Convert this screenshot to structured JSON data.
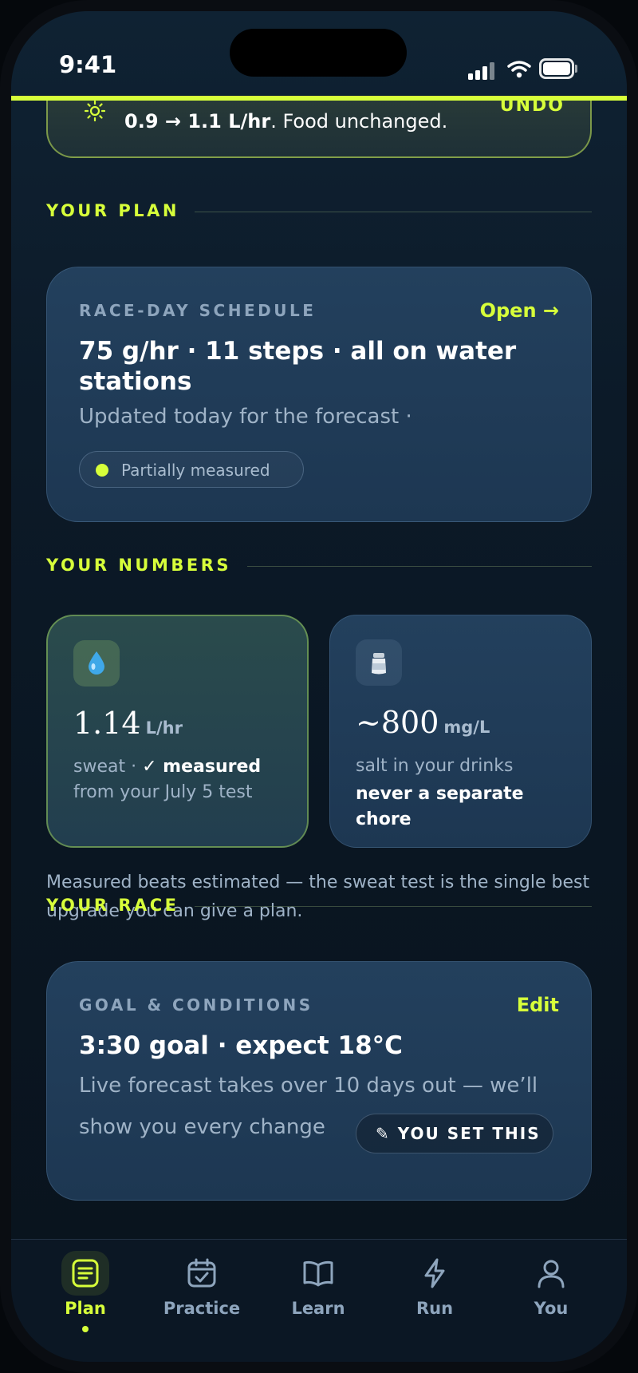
{
  "status": {
    "time": "9:41"
  },
  "banner": {
    "message_bold": "0.9 → 1.1 L/hr",
    "message_rest": ". Food unchanged.",
    "undo_label": "UNDO"
  },
  "sections": {
    "plan": "YOUR PLAN",
    "numbers": "YOUR NUMBERS",
    "race": "YOUR RACE"
  },
  "plan_card": {
    "eyebrow": "RACE-DAY SCHEDULE",
    "action": "Open →",
    "headline": "75 g/hr · 11 steps · all on water stations",
    "sub": "Updated today for the forecast ·",
    "pill": "Partially measured"
  },
  "numbers": {
    "sweat": {
      "icon": "water-drop-icon",
      "value": "1.14",
      "unit": "L/hr",
      "line1_pre": "sweat · ",
      "line1_bold": "✓ measured",
      "line2": "from your July 5 test"
    },
    "salt": {
      "icon": "salt-shaker-icon",
      "value": "~800",
      "unit": "mg/L",
      "line1": "salt in your drinks",
      "line2_bold": "never a separate chore"
    },
    "note": "Measured beats estimated — the sweat test is the single best upgrade you can give a plan."
  },
  "race_card": {
    "eyebrow": "GOAL & CONDITIONS",
    "action": "Edit",
    "headline": "3:30 goal · expect 18°C",
    "sub1": "Live forecast takes over 10 days out — we’ll",
    "sub2": "show you every change",
    "tag": "✎ YOU SET THIS"
  },
  "tabs": [
    {
      "label": "Plan",
      "icon": "plan-doc-icon",
      "active": true
    },
    {
      "label": "Practice",
      "icon": "calendar-check-icon",
      "active": false
    },
    {
      "label": "Learn",
      "icon": "book-icon",
      "active": false
    },
    {
      "label": "Run",
      "icon": "bolt-icon",
      "active": false
    },
    {
      "label": "You",
      "icon": "person-icon",
      "active": false
    }
  ],
  "colors": {
    "accent": "#d7ff3a",
    "card": "#23405d",
    "muted": "#9fb3c7"
  }
}
